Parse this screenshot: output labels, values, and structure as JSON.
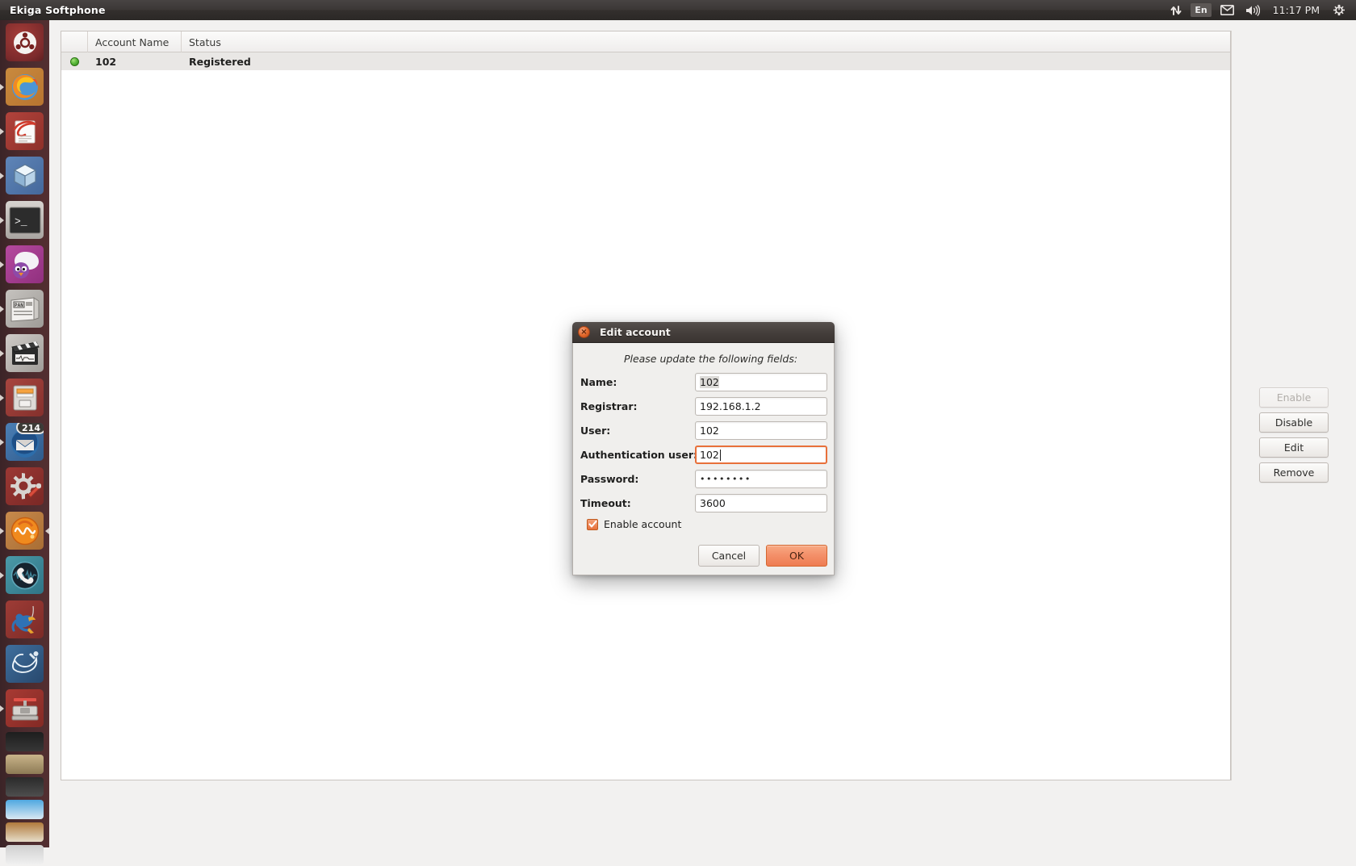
{
  "top_panel": {
    "app_title": "Ekiga Softphone",
    "indicators": [
      {
        "name": "network-icon",
        "glyph": "network"
      },
      {
        "name": "keyboard-layout-indicator",
        "label": "En"
      },
      {
        "name": "messaging-icon",
        "glyph": "envelope"
      },
      {
        "name": "volume-icon",
        "glyph": "speaker"
      }
    ],
    "clock": "11:17 PM",
    "session_icon": "power-gear-icon"
  },
  "launcher": {
    "items": [
      {
        "name": "dash-home",
        "label": "Ubuntu Dash Home",
        "icon": "ubuntu-logo-icon",
        "running": false,
        "badge": null
      },
      {
        "name": "firefox",
        "label": "Firefox Web Browser",
        "icon": "firefox-icon",
        "running": true,
        "badge": null
      },
      {
        "name": "writer",
        "label": "Document Editor",
        "icon": "document-editor-icon",
        "running": true,
        "badge": null
      },
      {
        "name": "virtualbox",
        "label": "VirtualBox",
        "icon": "blue-cube-icon",
        "running": true,
        "badge": null
      },
      {
        "name": "terminal",
        "label": "Terminal",
        "icon": "terminal-icon",
        "running": true,
        "badge": null
      },
      {
        "name": "pidgin",
        "label": "Pidgin Internet Messenger",
        "icon": "purple-bird-icon",
        "running": true,
        "badge": null
      },
      {
        "name": "pan",
        "label": "Pan Newsreader",
        "icon": "newspaper-icon",
        "running": true,
        "badge": null
      },
      {
        "name": "video-editor",
        "label": "Video Editor",
        "icon": "clapperboard-icon",
        "running": true,
        "badge": null
      },
      {
        "name": "file-manager",
        "label": "Files",
        "icon": "file-cabinet-icon",
        "running": true,
        "badge": null
      },
      {
        "name": "thunderbird",
        "label": "Thunderbird Mail",
        "icon": "thunderbird-icon",
        "running": true,
        "badge": "214"
      },
      {
        "name": "system-tools",
        "label": "System Tools",
        "icon": "gear-wrench-icon",
        "running": false,
        "badge": null
      },
      {
        "name": "audio-editor",
        "label": "Audio Editor",
        "icon": "orange-waveform-icon",
        "running": true,
        "focused": true,
        "badge": null
      },
      {
        "name": "ekiga",
        "label": "Ekiga Softphone",
        "icon": "telephone-icon",
        "running": true,
        "badge": null
      },
      {
        "name": "diver-app",
        "label": "Diver Application",
        "icon": "blue-diver-icon",
        "running": false,
        "badge": null
      },
      {
        "name": "mysql-workbench",
        "label": "MySQL Workbench",
        "icon": "dolphin-wrench-icon",
        "running": false,
        "badge": null
      },
      {
        "name": "archive-manager",
        "label": "Archive Manager",
        "icon": "vise-icon",
        "running": true,
        "badge": null
      }
    ]
  },
  "main_window": {
    "table": {
      "columns": [
        "",
        "Account Name",
        "Status"
      ],
      "rows": [
        {
          "indicator": "registered-green-dot",
          "account_name": "102",
          "status": "Registered"
        }
      ]
    },
    "side_buttons": [
      {
        "name": "enable-button",
        "label": "Enable",
        "enabled": false
      },
      {
        "name": "disable-button",
        "label": "Disable",
        "enabled": true
      },
      {
        "name": "edit-button",
        "label": "Edit",
        "enabled": true
      },
      {
        "name": "remove-button",
        "label": "Remove",
        "enabled": true
      }
    ]
  },
  "dialog": {
    "title": "Edit account",
    "close_glyph": "×",
    "subtitle": "Please update the following fields:",
    "fields": [
      {
        "name": "name-field",
        "label": "Name:",
        "value": "102",
        "focused": false,
        "selected": true,
        "type": "text"
      },
      {
        "name": "registrar-field",
        "label": "Registrar:",
        "value": "192.168.1.2",
        "focused": false,
        "selected": false,
        "type": "text"
      },
      {
        "name": "user-field",
        "label": "User:",
        "value": "102",
        "focused": false,
        "selected": false,
        "type": "text"
      },
      {
        "name": "authentication-user-field",
        "label": "Authentication user:",
        "value": "102",
        "focused": true,
        "selected": false,
        "type": "text"
      },
      {
        "name": "password-field",
        "label": "Password:",
        "value": "••••••••",
        "focused": false,
        "selected": false,
        "type": "password"
      },
      {
        "name": "timeout-field",
        "label": "Timeout:",
        "value": "3600",
        "focused": false,
        "selected": false,
        "type": "text"
      }
    ],
    "checkbox": {
      "label": "Enable account",
      "checked": true
    },
    "buttons": {
      "cancel": "Cancel",
      "ok": "OK"
    }
  },
  "colors": {
    "accent_orange": "#e8703a",
    "panel_dark": "#3c3836",
    "launcher_maroon": "#4a2a2d",
    "status_green": "#5cba3c"
  }
}
